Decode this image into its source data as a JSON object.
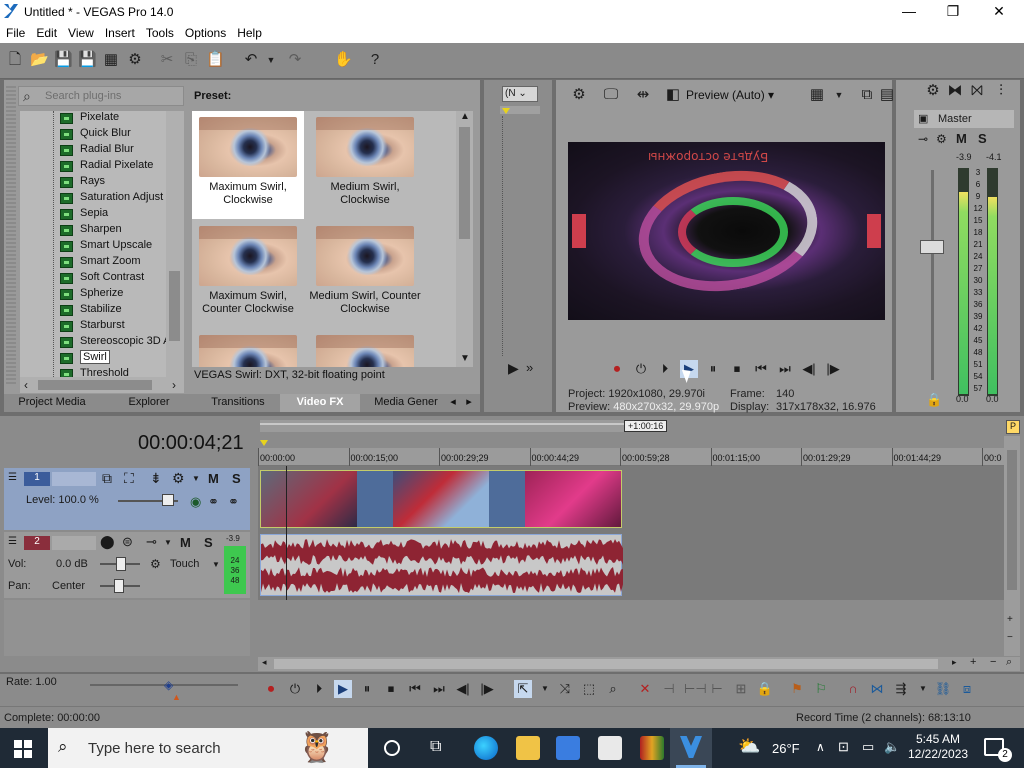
{
  "window": {
    "title": "Untitled * - VEGAS Pro 14.0",
    "min": "—",
    "max": "❐",
    "close": "✕"
  },
  "menu": [
    "File",
    "Edit",
    "View",
    "Insert",
    "Tools",
    "Options",
    "Help"
  ],
  "fx": {
    "search_placeholder": "Search plug-ins",
    "preset_label": "Preset:",
    "tree_items": [
      "Pixelate",
      "Quick Blur",
      "Radial Blur",
      "Radial Pixelate",
      "Rays",
      "Saturation Adjust",
      "Sepia",
      "Sharpen",
      "Smart Upscale",
      "Smart Zoom",
      "Soft Contrast",
      "Spherize",
      "Stabilize",
      "Starburst",
      "Stereoscopic 3D A",
      "Swirl",
      "Threshold"
    ],
    "selected_item": "Swirl",
    "presets": [
      "Maximum Swirl, Clockwise",
      "Medium Swirl, Clockwise",
      "Maximum Swirl, Counter Clockwise",
      "Medium Swirl, Counter Clockwise"
    ],
    "status": "VEGAS Swirl: DXT, 32-bit floating point",
    "tabs": [
      "Project Media",
      "Explorer",
      "Transitions",
      "Video FX",
      "Media Gener"
    ]
  },
  "trimmer": {
    "dropdown": "(N"
  },
  "preview": {
    "quality": "Preview (Auto)",
    "video_text": "Будьте осторожны",
    "project_label": "Project:",
    "project_value": "1920x1080, 29.970i",
    "frame_label": "Frame:",
    "frame_value": "140",
    "preview_label": "Preview:",
    "preview_value": "480x270x32, 29.970p",
    "display_label": "Display:",
    "display_value": "317x178x32, 16.976"
  },
  "master": {
    "label": "Master",
    "peak_l": "-3.9",
    "peak_r": "-4.1",
    "scale": [
      "3",
      "6",
      "9",
      "12",
      "15",
      "18",
      "21",
      "24",
      "27",
      "30",
      "33",
      "36",
      "39",
      "42",
      "45",
      "48",
      "51",
      "54",
      "57"
    ],
    "val_l": "0.0",
    "val_r": "0.0",
    "level_l": 0.9,
    "level_r": 0.88
  },
  "timeline": {
    "timecode": "00:00:04;21",
    "marker": "+1:00:16",
    "ruler": [
      "00:00:00",
      "00:00:15;00",
      "00:00:29;29",
      "00:00:44;29",
      "00:00:59;28",
      "00:01:15;00",
      "00:01:29;29",
      "00:01:44;29",
      "00:0"
    ],
    "video_track": {
      "number": "1",
      "level": "Level: 100.0 %"
    },
    "audio_track": {
      "number": "2",
      "vol_label": "Vol:",
      "vol_value": "0.0 dB",
      "pan_label": "Pan:",
      "pan_value": "Center",
      "touch": "Touch",
      "peak": "-3.9",
      "meter_scale": [
        "24",
        "36",
        "48"
      ]
    },
    "rate": "Rate: 1.00"
  },
  "status": {
    "complete": "Complete: 00:00:00",
    "record_time": "Record Time (2 channels): 68:13:10"
  },
  "taskbar": {
    "search": "Type here to search",
    "weather": "26°F",
    "time": "5:45 AM",
    "date": "12/22/2023",
    "notifications": "2"
  }
}
